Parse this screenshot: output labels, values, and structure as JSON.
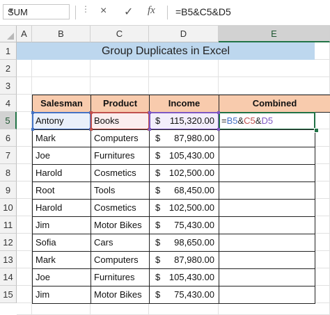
{
  "formula_bar": {
    "name_box": "SUM",
    "cancel_icon": "×",
    "enter_icon": "✓",
    "fx_label": "fx",
    "formula": "=B5&C5&D5"
  },
  "columns": [
    "A",
    "B",
    "C",
    "D",
    "E"
  ],
  "rows": [
    "1",
    "2",
    "3",
    "4",
    "5",
    "6",
    "7",
    "8",
    "9",
    "10",
    "11",
    "12",
    "13",
    "14",
    "15"
  ],
  "selected_column": "E",
  "selected_row": "5",
  "title": "Group Duplicates in Excel",
  "table": {
    "headers": [
      "Salesman",
      "Product",
      "Income",
      "Combined"
    ],
    "rows": [
      {
        "salesman": "Antony",
        "product": "Books",
        "currency": "$",
        "income": "115,320.00",
        "combined": ""
      },
      {
        "salesman": "Mark",
        "product": "Computers",
        "currency": "$",
        "income": "87,980.00",
        "combined": ""
      },
      {
        "salesman": "Joe",
        "product": "Furnitures",
        "currency": "$",
        "income": "105,430.00",
        "combined": ""
      },
      {
        "salesman": "Harold",
        "product": "Cosmetics",
        "currency": "$",
        "income": "102,500.00",
        "combined": ""
      },
      {
        "salesman": "Root",
        "product": "Tools",
        "currency": "$",
        "income": "68,450.00",
        "combined": ""
      },
      {
        "salesman": "Harold",
        "product": "Cosmetics",
        "currency": "$",
        "income": "102,500.00",
        "combined": ""
      },
      {
        "salesman": "Jim",
        "product": "Motor Bikes",
        "currency": "$",
        "income": "75,430.00",
        "combined": ""
      },
      {
        "salesman": "Sofia",
        "product": "Cars",
        "currency": "$",
        "income": "98,650.00",
        "combined": ""
      },
      {
        "salesman": "Mark",
        "product": "Computers",
        "currency": "$",
        "income": "87,980.00",
        "combined": ""
      },
      {
        "salesman": "Joe",
        "product": "Furnitures",
        "currency": "$",
        "income": "105,430.00",
        "combined": ""
      },
      {
        "salesman": "Jim",
        "product": "Motor Bikes",
        "currency": "$",
        "income": "75,430.00",
        "combined": ""
      }
    ]
  },
  "editing_cell": {
    "parts": [
      {
        "text": "=",
        "color": "#222222"
      },
      {
        "text": "B5",
        "color": "#4472c4"
      },
      {
        "text": "&",
        "color": "#222222"
      },
      {
        "text": "C5",
        "color": "#c0504d"
      },
      {
        "text": "&",
        "color": "#222222"
      },
      {
        "text": "D5",
        "color": "#7e57c2"
      }
    ]
  },
  "colors": {
    "title_fill": "#bdd7ee",
    "header_fill": "#f8cbad",
    "ref_b": "#4472c4",
    "ref_c": "#c0504d",
    "ref_d": "#7e57c2",
    "active": "#217346"
  }
}
